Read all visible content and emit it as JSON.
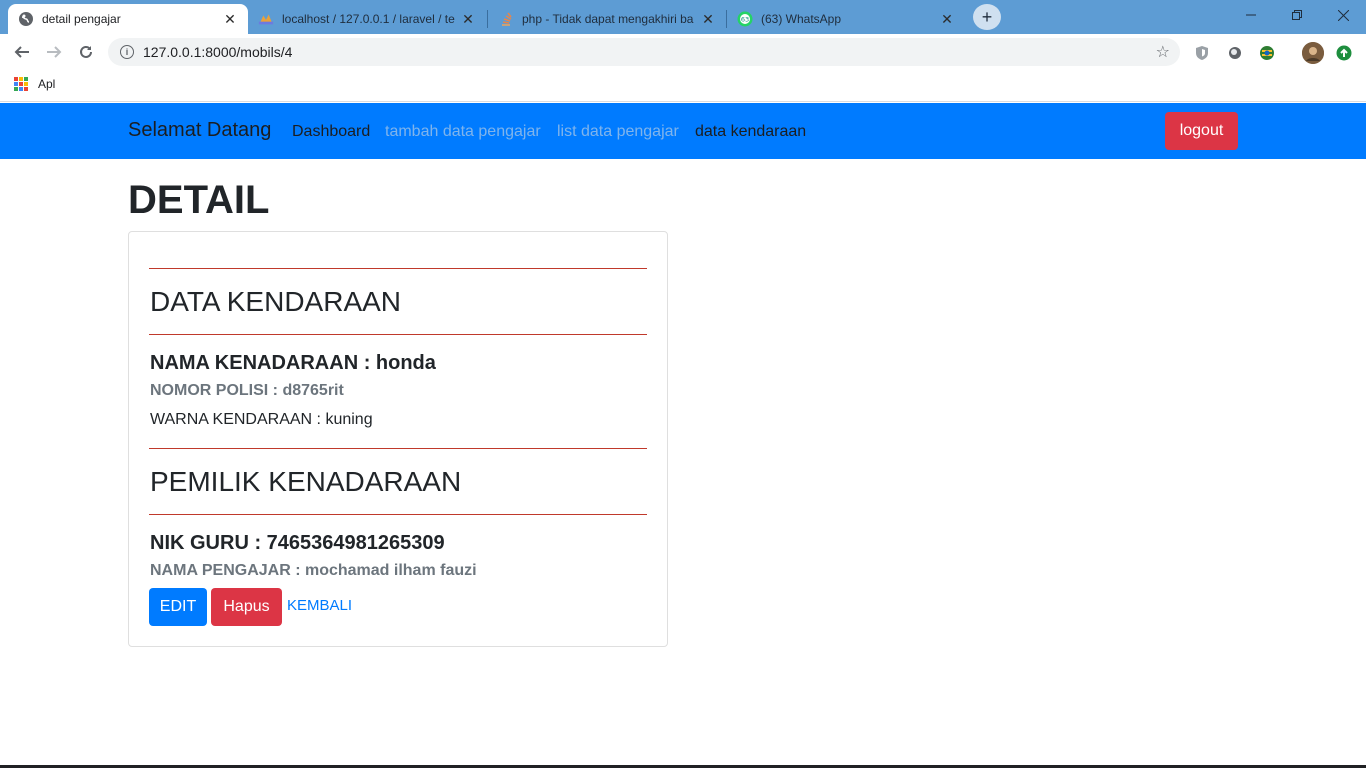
{
  "browser": {
    "tabs": [
      {
        "title": "detail pengajar",
        "active": true
      },
      {
        "title": "localhost / 127.0.0.1 / laravel / te",
        "active": false
      },
      {
        "title": "php - Tidak dapat mengakhiri ba",
        "active": false
      },
      {
        "title": "(63) WhatsApp",
        "active": false
      }
    ],
    "whatsapp_badge": "63",
    "url": "127.0.0.1:8000/mobils/4",
    "bookmarks_apps_label": "Apl"
  },
  "navbar": {
    "brand": "Selamat Datang",
    "links": [
      {
        "label": "Dashboard",
        "color": "#1b1e21"
      },
      {
        "label": "tambah data pengajar",
        "color": "#7fb4ec"
      },
      {
        "label": "list data pengajar",
        "color": "#7fb4ec"
      },
      {
        "label": "data kendaraan",
        "color": "#1b1e21"
      }
    ],
    "logout_label": "logout"
  },
  "page": {
    "heading": "DETAIL",
    "vehicle_section_title": "DATA KENDARAAN",
    "vehicle_name": "NAMA KENADARAAN : honda",
    "plate_number": "NOMOR POLISI : d8765rit",
    "vehicle_color": "WARNA KENDARAAN : kuning",
    "owner_section_title": "PEMILIK KENADARAAN",
    "teacher_nik": "NIK GURU : 7465364981265309",
    "teacher_name": "NAMA PENGAJAR : mochamad ilham fauzi",
    "edit_label": "EDIT",
    "delete_label": "Hapus",
    "back_label": "KEMBALI"
  },
  "colors": {
    "navbar_bg": "#007bff",
    "primary": "#007bff",
    "danger": "#dc3545",
    "rule": "#c0392b"
  }
}
